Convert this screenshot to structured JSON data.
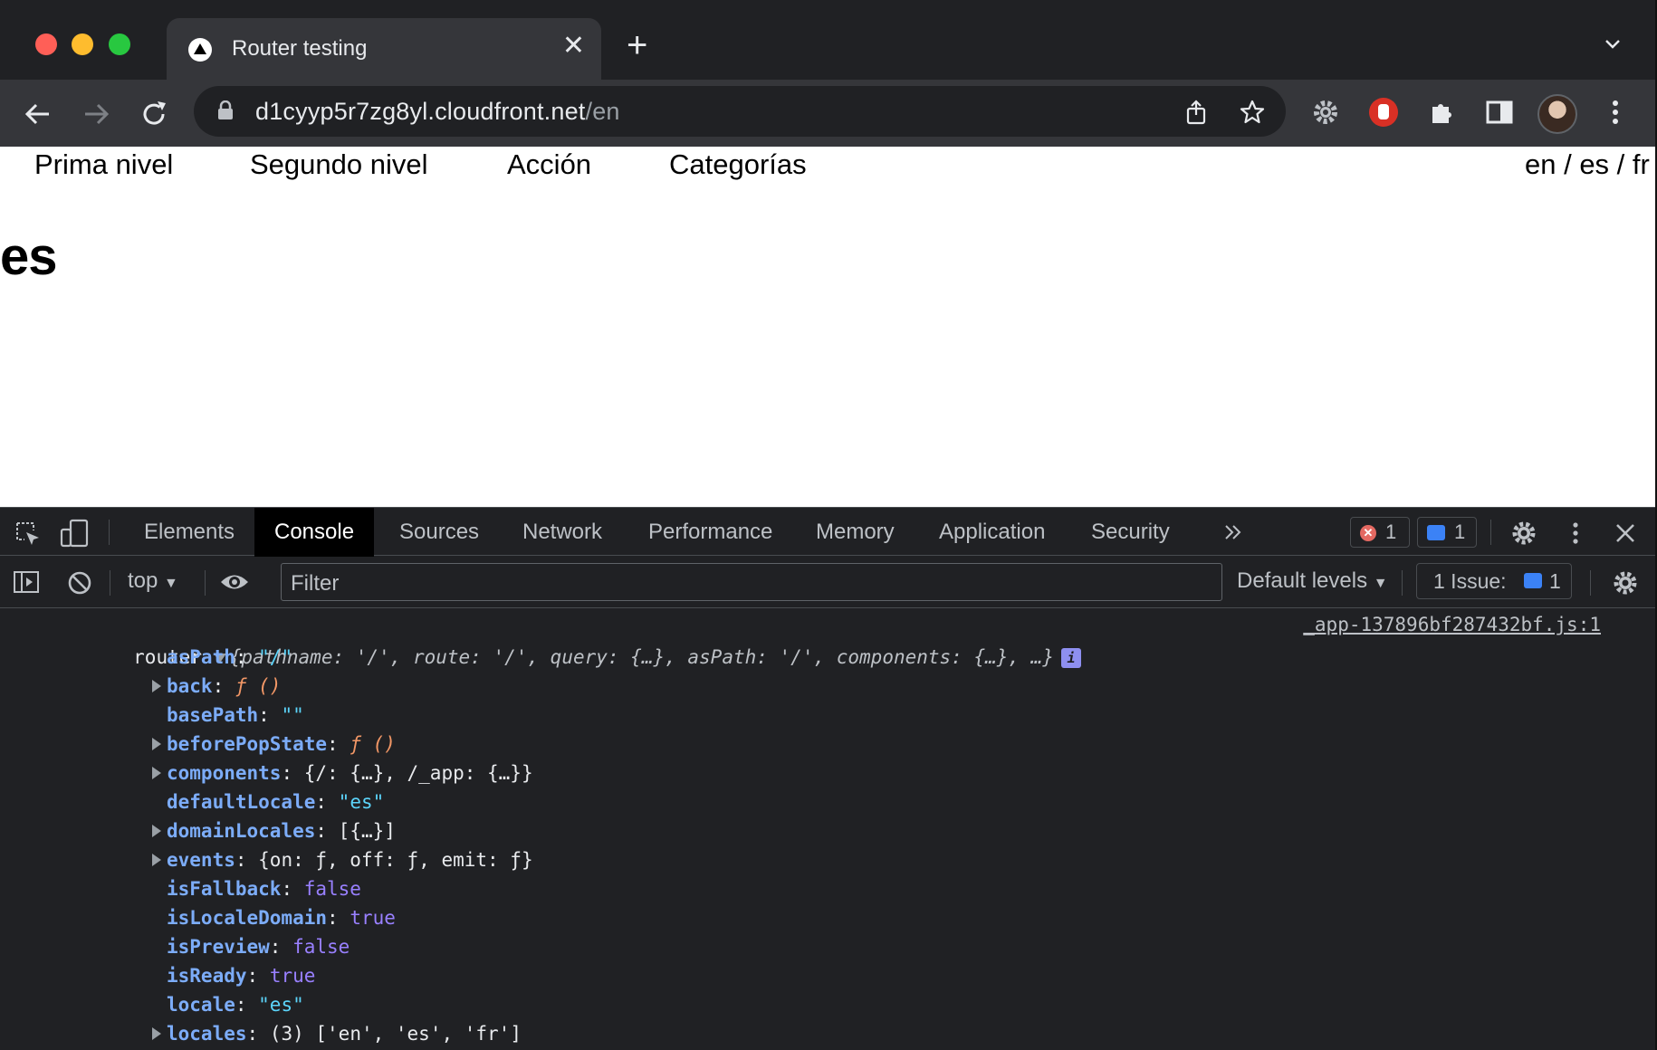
{
  "browser": {
    "tab_title": "Router testing",
    "url_host": "d1cyyp5r7zg8yl.cloudfront.net",
    "url_path": "/en"
  },
  "page": {
    "nav": [
      "Prima nivel",
      "Segundo nivel",
      "Acción",
      "Categorías"
    ],
    "locale_switch": "en / es / fr",
    "heading": "es"
  },
  "devtools": {
    "tabs": [
      "Elements",
      "Console",
      "Sources",
      "Network",
      "Performance",
      "Memory",
      "Application",
      "Security"
    ],
    "active_tab": "Console",
    "error_count": "1",
    "message_count": "1",
    "context": "top",
    "filter_placeholder": "Filter",
    "levels": "Default levels",
    "issues_label": "1 Issue:",
    "issues_count": "1"
  },
  "console": {
    "label": "router",
    "summary": "{pathname: '/', route: '/', query: {…}, asPath: '/', components: {…}, …}",
    "info_badge": "i",
    "source": "_app-137896bf287432bf.js:1",
    "props": [
      {
        "key": "asPath",
        "value": "\"/\"",
        "type": "str",
        "expandable": false
      },
      {
        "key": "back",
        "value": "ƒ ()",
        "type": "fn",
        "expandable": true
      },
      {
        "key": "basePath",
        "value": "\"\"",
        "type": "str",
        "expandable": false
      },
      {
        "key": "beforePopState",
        "value": "ƒ ()",
        "type": "fn",
        "expandable": true
      },
      {
        "key": "components",
        "value": "{/: {…}, /_app: {…}}",
        "type": "plain",
        "expandable": true
      },
      {
        "key": "defaultLocale",
        "value": "\"es\"",
        "type": "str",
        "expandable": false
      },
      {
        "key": "domainLocales",
        "value": "[{…}]",
        "type": "plain",
        "expandable": true
      },
      {
        "key": "events",
        "value": "{on: ƒ, off: ƒ, emit: ƒ}",
        "type": "plain",
        "expandable": true
      },
      {
        "key": "isFallback",
        "value": "false",
        "type": "bool",
        "expandable": false
      },
      {
        "key": "isLocaleDomain",
        "value": "true",
        "type": "bool",
        "expandable": false
      },
      {
        "key": "isPreview",
        "value": "false",
        "type": "bool",
        "expandable": false
      },
      {
        "key": "isReady",
        "value": "true",
        "type": "bool",
        "expandable": false
      },
      {
        "key": "locale",
        "value": "\"es\"",
        "type": "str",
        "expandable": false
      },
      {
        "key": "locales",
        "value": "(3) ['en', 'es', 'fr']",
        "type": "plain",
        "expandable": true
      }
    ]
  }
}
